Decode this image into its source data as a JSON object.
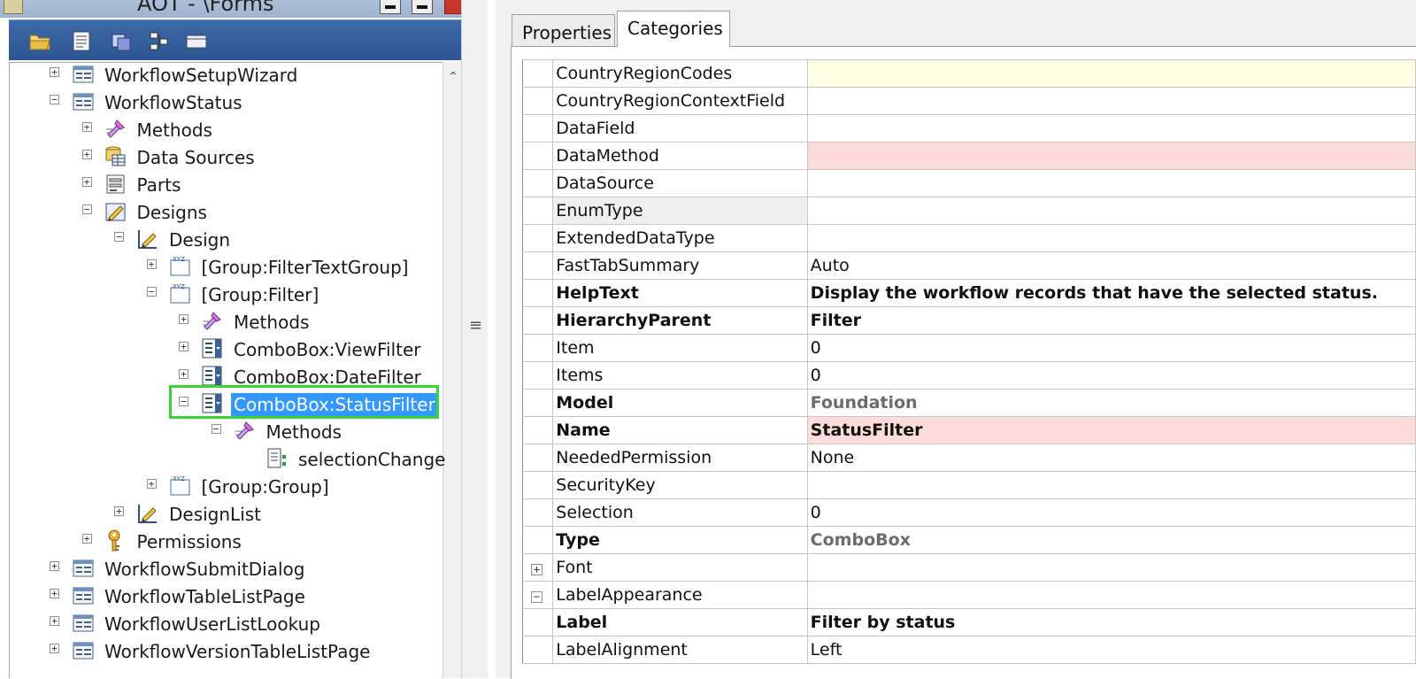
{
  "window": {
    "title": "AOT - \\Forms"
  },
  "toolbar": {
    "icons": [
      "open-folder-icon",
      "properties-icon",
      "compile-icon",
      "import-icon",
      "save-all-icon"
    ]
  },
  "tree": {
    "nodes": [
      {
        "label": "WorkflowSetupWizard",
        "expander": "+",
        "icon": "form-icon"
      },
      {
        "label": "WorkflowStatus",
        "expander": "−",
        "icon": "form-icon"
      },
      {
        "label": "Methods",
        "expander": "+",
        "icon": "methods-icon"
      },
      {
        "label": "Data Sources",
        "expander": "+",
        "icon": "data-sources-icon"
      },
      {
        "label": "Parts",
        "expander": "+",
        "icon": "parts-icon"
      },
      {
        "label": "Designs",
        "expander": "−",
        "icon": "designs-icon"
      },
      {
        "label": "Design",
        "expander": "−",
        "icon": "design-icon"
      },
      {
        "label": "[Group:FilterTextGroup]",
        "expander": "+",
        "icon": "group-icon"
      },
      {
        "label": "[Group:Filter]",
        "expander": "−",
        "icon": "group-icon"
      },
      {
        "label": "Methods",
        "expander": "+",
        "icon": "methods-icon"
      },
      {
        "label": "ComboBox:ViewFilter",
        "expander": "+",
        "icon": "combobox-icon"
      },
      {
        "label": "ComboBox:DateFilter",
        "expander": "+",
        "icon": "combobox-icon"
      },
      {
        "label": "ComboBox:StatusFilter",
        "expander": "−",
        "icon": "combobox-icon",
        "selected": true
      },
      {
        "label": "Methods",
        "expander": "−",
        "icon": "methods-icon"
      },
      {
        "label": "selectionChange",
        "expander": "",
        "icon": "method-icon"
      },
      {
        "label": "[Group:Group]",
        "expander": "+",
        "icon": "group-icon"
      },
      {
        "label": "DesignList",
        "expander": "+",
        "icon": "design-icon"
      },
      {
        "label": "Permissions",
        "expander": "+",
        "icon": "key-icon"
      },
      {
        "label": "WorkflowSubmitDialog",
        "expander": "+",
        "icon": "form-icon"
      },
      {
        "label": "WorkflowTableListPage",
        "expander": "+",
        "icon": "form-icon"
      },
      {
        "label": "WorkflowUserListLookup",
        "expander": "+",
        "icon": "form-icon"
      },
      {
        "label": "WorkflowVersionTableListPage",
        "expander": "+",
        "icon": "form-icon"
      }
    ]
  },
  "tabs": {
    "properties": "Properties",
    "categories": "Categories",
    "active": "Categories"
  },
  "properties": [
    {
      "name": "CountryRegionCodes",
      "value": "",
      "bg": "yellow"
    },
    {
      "name": "CountryRegionContextField",
      "value": ""
    },
    {
      "name": "DataField",
      "value": ""
    },
    {
      "name": "DataMethod",
      "value": "",
      "bg": "pink"
    },
    {
      "name": "DataSource",
      "value": ""
    },
    {
      "name": "EnumType",
      "value": "",
      "highlight": true
    },
    {
      "name": "ExtendedDataType",
      "value": ""
    },
    {
      "name": "FastTabSummary",
      "value": "Auto"
    },
    {
      "name": "HelpText",
      "value": "Display the workflow records that have the selected status.",
      "bold": true
    },
    {
      "name": "HierarchyParent",
      "value": "Filter",
      "bold": true
    },
    {
      "name": "Item",
      "value": "0"
    },
    {
      "name": "Items",
      "value": "0"
    },
    {
      "name": "Model",
      "value": "Foundation",
      "bold": true,
      "inherited": true
    },
    {
      "name": "Name",
      "value": "StatusFilter",
      "bold": true,
      "bg": "pink"
    },
    {
      "name": "NeededPermission",
      "value": "None"
    },
    {
      "name": "SecurityKey",
      "value": ""
    },
    {
      "name": "Selection",
      "value": "0"
    },
    {
      "name": "Type",
      "value": "ComboBox",
      "bold": true,
      "inherited": true
    },
    {
      "name": "Font",
      "value": "",
      "expander": "+"
    },
    {
      "name": "LabelAppearance",
      "value": "",
      "expander": "−"
    },
    {
      "name": "Label",
      "value": "Filter by status",
      "bold": true
    },
    {
      "name": "LabelAlignment",
      "value": "Left"
    }
  ],
  "colors": {
    "selection": "#3399ff",
    "highlight_box": "#33d633",
    "toolbar": "#2c5591",
    "pink_row": "#ffdcdc",
    "yellow_row": "#ffffe5"
  }
}
